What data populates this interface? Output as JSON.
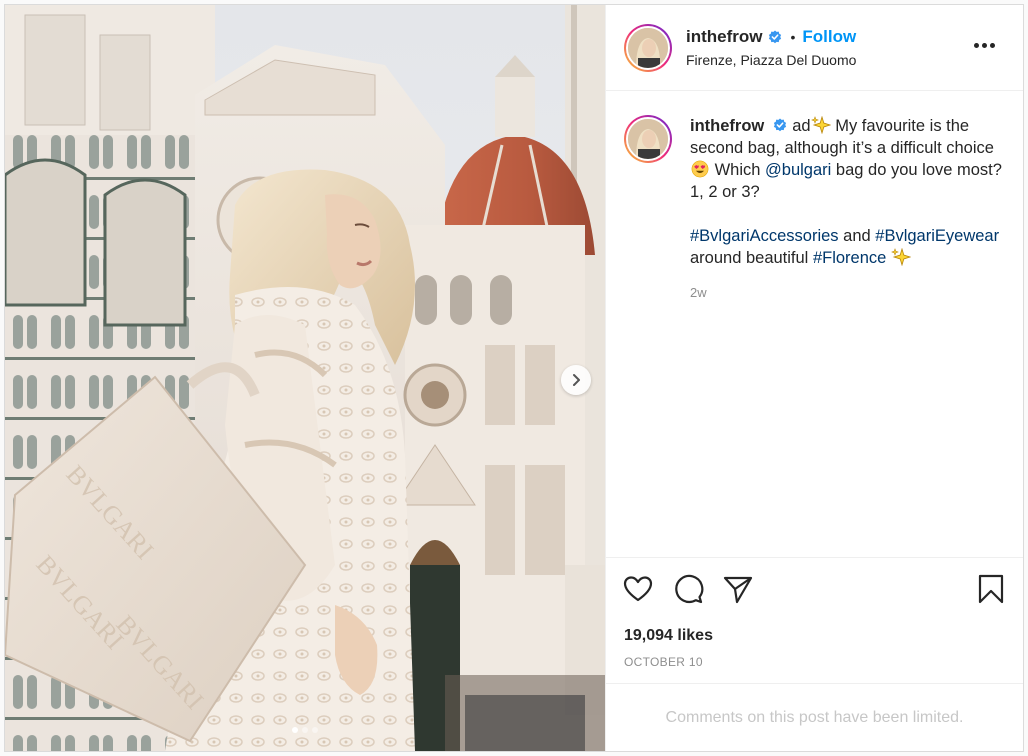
{
  "post": {
    "username": "inthefrow",
    "follow_label": "Follow",
    "bullet": "•",
    "location": "Firenze, Piazza Del Duomo",
    "media": {
      "slide_count": 3,
      "active_slide": 1
    }
  },
  "caption": {
    "username": "inthefrow",
    "prefix": "ad",
    "text1": "My favourite is the second bag, although it’s a difficult choice",
    "text2": "Which",
    "mention": "@bulgari",
    "text3": "bag do you love most? 1, 2 or 3?",
    "hashtag1": "#BvlgariAccessories",
    "and": "and",
    "hashtag2": "#BvlgariEyewear",
    "text4": "around beautiful",
    "hashtag3": "#Florence",
    "time": "2w"
  },
  "stats": {
    "likes": "19,094 likes",
    "date": "OCTOBER 10"
  },
  "comments_notice": "Comments on this post have been limited.",
  "icons": [
    "verified-badge-icon",
    "more-options-icon",
    "heart-icon",
    "comment-icon",
    "share-icon",
    "bookmark-icon",
    "chevron-right-icon",
    "sparkles-icon",
    "heart-eyes-emoji"
  ],
  "colors": {
    "follow": "#0095f6",
    "link": "#00376b",
    "verified": "#3897f0",
    "muted": "#8e8e8e"
  }
}
